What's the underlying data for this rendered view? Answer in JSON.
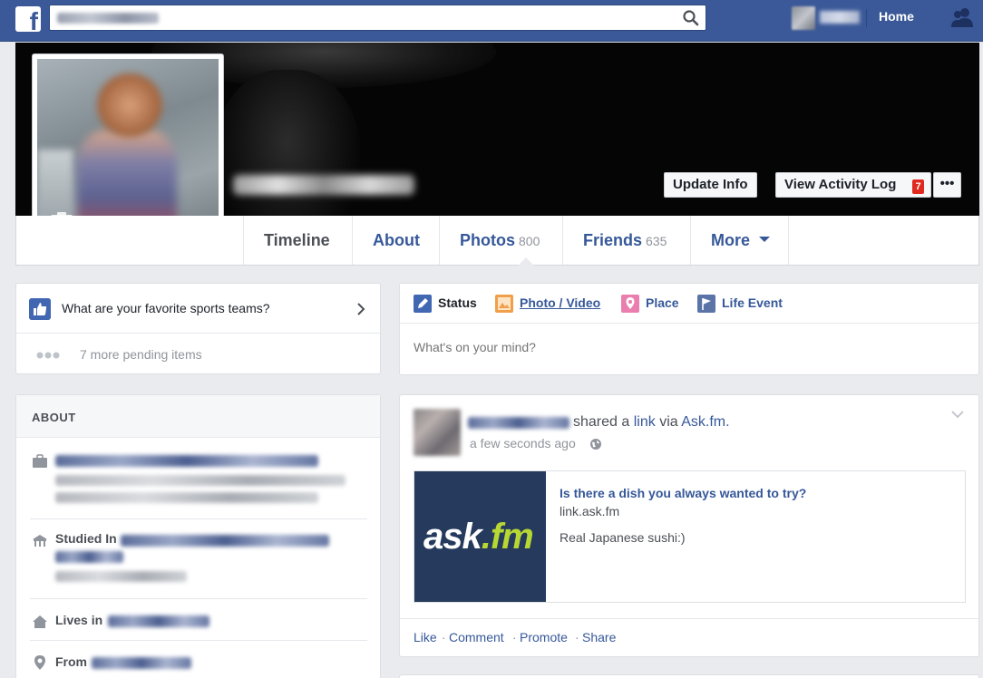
{
  "topbar": {
    "search_placeholder": "",
    "home_label": "Home"
  },
  "cover": {
    "update_info_label": "Update Info",
    "activity_log_label": "View Activity Log",
    "activity_badge": "7",
    "more_label": "•••"
  },
  "tabs": [
    {
      "label": "Timeline",
      "count": ""
    },
    {
      "label": "About",
      "count": ""
    },
    {
      "label": "Photos",
      "count": "800"
    },
    {
      "label": "Friends",
      "count": "635"
    },
    {
      "label": "More",
      "count": ""
    }
  ],
  "prompt": {
    "question": "What are your favorite sports teams?",
    "pending": "7 more pending items"
  },
  "about": {
    "title": "ABOUT",
    "studied_label": "Studied In",
    "lives_label": "Lives in",
    "from_label": "From"
  },
  "composer": {
    "tabs": [
      "Status",
      "Photo / Video",
      "Place",
      "Life Event"
    ],
    "placeholder": "What's on your mind?"
  },
  "post": {
    "shared": "shared a",
    "link_word": "link",
    "via": "via",
    "via_app": "Ask.fm.",
    "time": "a few seconds ago",
    "link_title": "Is there a dish you always wanted to try?",
    "link_url": "link.ask.fm",
    "link_desc": "Real Japanese sushi:)",
    "logo_text": "ask",
    "logo_suffix": ".fm",
    "actions": [
      "Like",
      "Comment",
      "Promote",
      "Share"
    ]
  }
}
